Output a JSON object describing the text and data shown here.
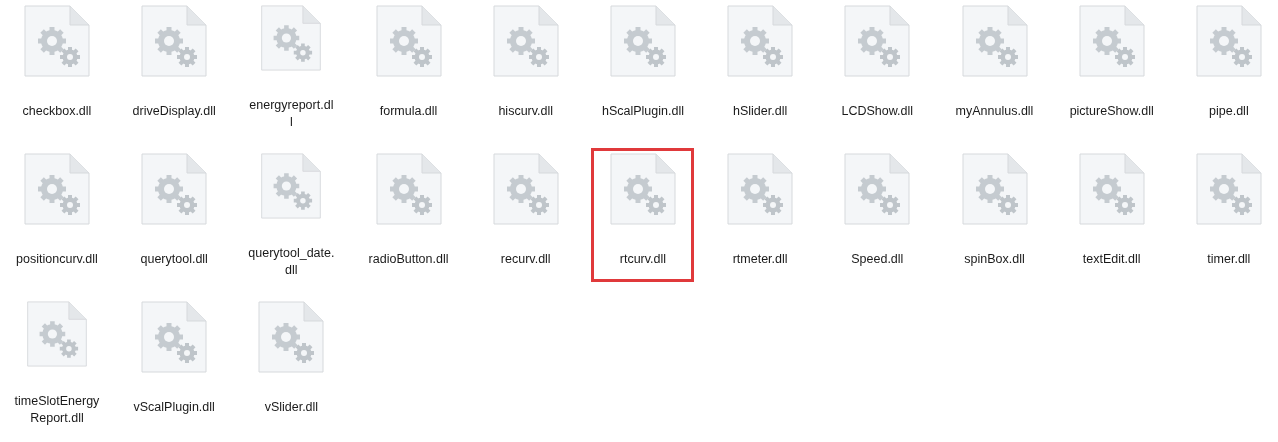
{
  "files": [
    {
      "lines": [
        "checkbox.dll"
      ],
      "highlighted": false
    },
    {
      "lines": [
        "driveDisplay.dll"
      ],
      "highlighted": false
    },
    {
      "lines": [
        "energyreport.dl",
        "l"
      ],
      "highlighted": false
    },
    {
      "lines": [
        "formula.dll"
      ],
      "highlighted": false
    },
    {
      "lines": [
        "hiscurv.dll"
      ],
      "highlighted": false
    },
    {
      "lines": [
        "hScalPlugin.dll"
      ],
      "highlighted": false
    },
    {
      "lines": [
        "hSlider.dll"
      ],
      "highlighted": false
    },
    {
      "lines": [
        "LCDShow.dll"
      ],
      "highlighted": false
    },
    {
      "lines": [
        "myAnnulus.dll"
      ],
      "highlighted": false
    },
    {
      "lines": [
        "pictureShow.dll"
      ],
      "highlighted": false
    },
    {
      "lines": [
        "pipe.dll"
      ],
      "highlighted": false
    },
    {
      "lines": [
        "positioncurv.dll"
      ],
      "highlighted": false
    },
    {
      "lines": [
        "querytool.dll"
      ],
      "highlighted": false
    },
    {
      "lines": [
        "querytool_date.",
        "dll"
      ],
      "highlighted": false
    },
    {
      "lines": [
        "radioButton.dll"
      ],
      "highlighted": false
    },
    {
      "lines": [
        "recurv.dll"
      ],
      "highlighted": false
    },
    {
      "lines": [
        "rtcurv.dll"
      ],
      "highlighted": true
    },
    {
      "lines": [
        "rtmeter.dll"
      ],
      "highlighted": false
    },
    {
      "lines": [
        "Speed.dll"
      ],
      "highlighted": false
    },
    {
      "lines": [
        "spinBox.dll"
      ],
      "highlighted": false
    },
    {
      "lines": [
        "textEdit.dll"
      ],
      "highlighted": false
    },
    {
      "lines": [
        "timer.dll"
      ],
      "highlighted": false
    },
    {
      "lines": [
        "timeSlotEnergy",
        "Report.dll"
      ],
      "highlighted": false
    },
    {
      "lines": [
        "vScalPlugin.dll"
      ],
      "highlighted": false
    },
    {
      "lines": [
        "vSlider.dll"
      ],
      "highlighted": false
    }
  ]
}
